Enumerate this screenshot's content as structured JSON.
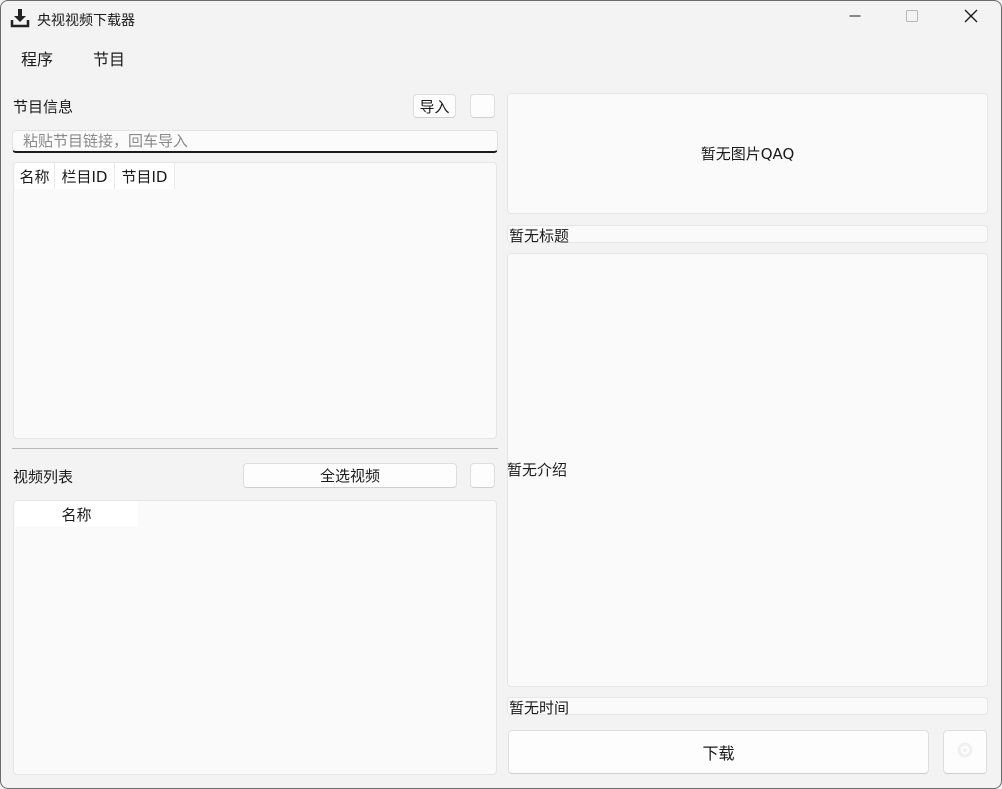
{
  "window": {
    "title": "央视视频下载器",
    "icons": {
      "app": "download-icon",
      "minimize": "minimize-icon",
      "maximize": "maximize-icon",
      "close": "close-icon"
    }
  },
  "menu": {
    "items": [
      {
        "label": "程序"
      },
      {
        "label": "节目"
      }
    ]
  },
  "program_info": {
    "label": "节目信息",
    "import_button": "导入",
    "input_placeholder": "粘贴节目链接，回车导入",
    "table_columns": [
      "名称",
      "栏目ID",
      "节目ID"
    ]
  },
  "video_list": {
    "label": "视频列表",
    "select_all_button": "全选视频",
    "table_columns": [
      "名称"
    ]
  },
  "details": {
    "image_placeholder": "暂无图片QAQ",
    "title": "暂无标题",
    "intro": "暂无介绍",
    "time": "暂无时间"
  },
  "actions": {
    "download_button": "下载",
    "settings_icon": "gear-icon"
  },
  "colors": {
    "background": "#f3f3f3",
    "panel": "#fafafa",
    "border": "#e6e6e6",
    "text": "#1a1a1a"
  }
}
